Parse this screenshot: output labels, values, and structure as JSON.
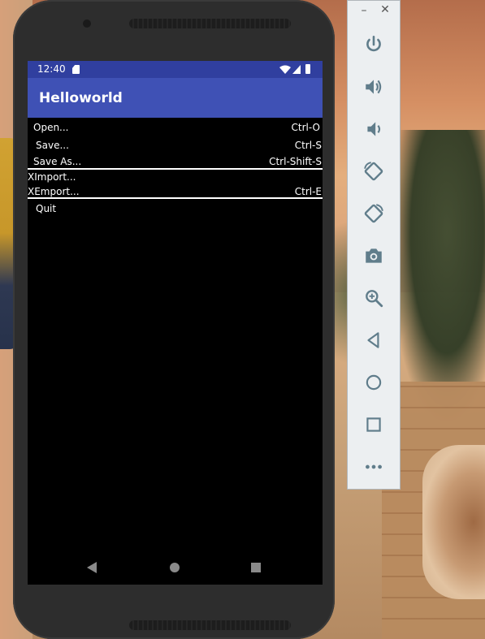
{
  "device": {
    "status_bar": {
      "time": "12:40"
    },
    "app_bar": {
      "title": "Helloworld"
    },
    "menu": {
      "items": [
        {
          "label": "Open...",
          "shortcut": "Ctrl-O"
        },
        {
          "label": "Save...",
          "shortcut": "Ctrl-S"
        },
        {
          "label": "Save As...",
          "shortcut": "Ctrl-Shift-S"
        },
        {
          "label": "XImport...",
          "shortcut": ""
        },
        {
          "label": "XEmport...",
          "shortcut": "Ctrl-E"
        },
        {
          "label": "Quit",
          "shortcut": ""
        }
      ]
    },
    "colors": {
      "status_bar": "#303f9f",
      "app_bar": "#3f51b5",
      "screen_bg": "#000000",
      "menu_text": "#ffffff"
    }
  },
  "emulator_toolbar": {
    "window_controls": {
      "minimize": "–",
      "close": "✕"
    },
    "buttons": [
      {
        "icon": "power-icon"
      },
      {
        "icon": "volume-up-icon"
      },
      {
        "icon": "volume-down-icon"
      },
      {
        "icon": "rotate-left-icon"
      },
      {
        "icon": "rotate-right-icon"
      },
      {
        "icon": "camera-icon"
      },
      {
        "icon": "zoom-icon"
      },
      {
        "icon": "back-icon"
      },
      {
        "icon": "home-icon"
      },
      {
        "icon": "overview-icon"
      },
      {
        "icon": "more-icon"
      }
    ],
    "icon_color": "#607d8b"
  }
}
